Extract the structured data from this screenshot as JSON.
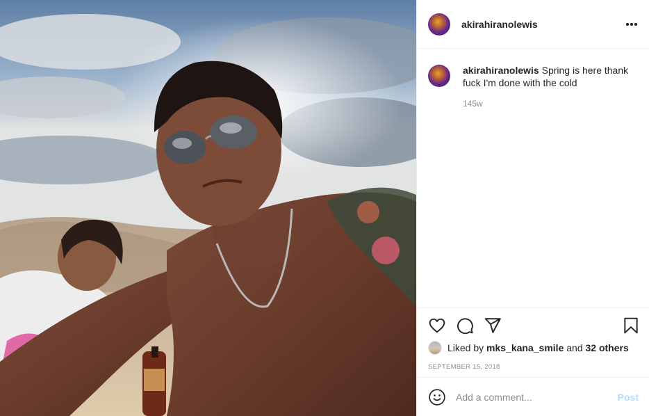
{
  "post": {
    "photo_icon": "beach-selfie-photo",
    "header": {
      "username": "akirahiranolewis",
      "more_icon": "more-horizontal-icon"
    },
    "caption": {
      "username": "akirahiranolewis",
      "text": "Spring is here thank fuck I'm done with the cold",
      "time": "145w"
    },
    "actions": {
      "like_icon": "heart-icon",
      "comment_icon": "comment-icon",
      "share_icon": "paper-plane-icon",
      "save_icon": "bookmark-icon"
    },
    "likes": {
      "prefix": "Liked by",
      "user": "mks_kana_smile",
      "middle": "and",
      "others": "32 others"
    },
    "date": "SEPTEMBER 15, 2018",
    "comment": {
      "emoji_icon": "emoji-smile-icon",
      "placeholder": "Add a comment...",
      "post_label": "Post"
    }
  },
  "colors": {
    "text": "#262626",
    "secondary": "#8e8e8e",
    "divider": "#efefef",
    "post_disabled": "#b2dffc"
  }
}
